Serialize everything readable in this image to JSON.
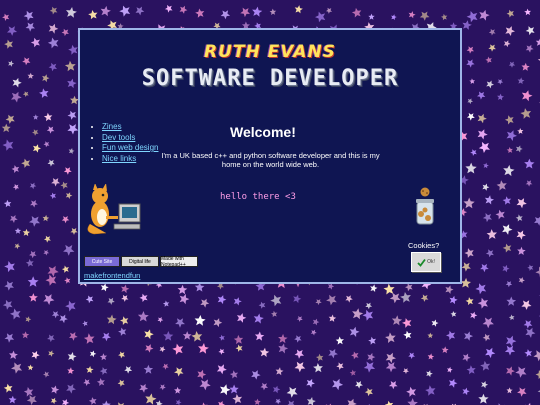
{
  "header": {
    "name": "RUTH EVANS",
    "title": "SOFTWARE DEVELOPER"
  },
  "nav": {
    "items": [
      {
        "label": "Zines"
      },
      {
        "label": "Dev tools"
      },
      {
        "label": "Fun web design"
      },
      {
        "label": "Nice links"
      }
    ]
  },
  "main": {
    "heading": "Welcome!",
    "intro": "I'm a UK based c++ and python software developer and this is my home on the world wide web.",
    "greeting": "hello there <3"
  },
  "cookies": {
    "label": "Cookies?",
    "button_label": "Ok!"
  },
  "badges": [
    {
      "label": "Cute Site"
    },
    {
      "label": "Digital life"
    },
    {
      "label": "Made with Notepad++"
    }
  ],
  "footer_link": "makefrontendfun",
  "colors": {
    "background": "#2a1260",
    "panel": "#0f1552",
    "border": "#9fb6e8",
    "link": "#7fd6ff",
    "accent": "#ff9ee8"
  }
}
